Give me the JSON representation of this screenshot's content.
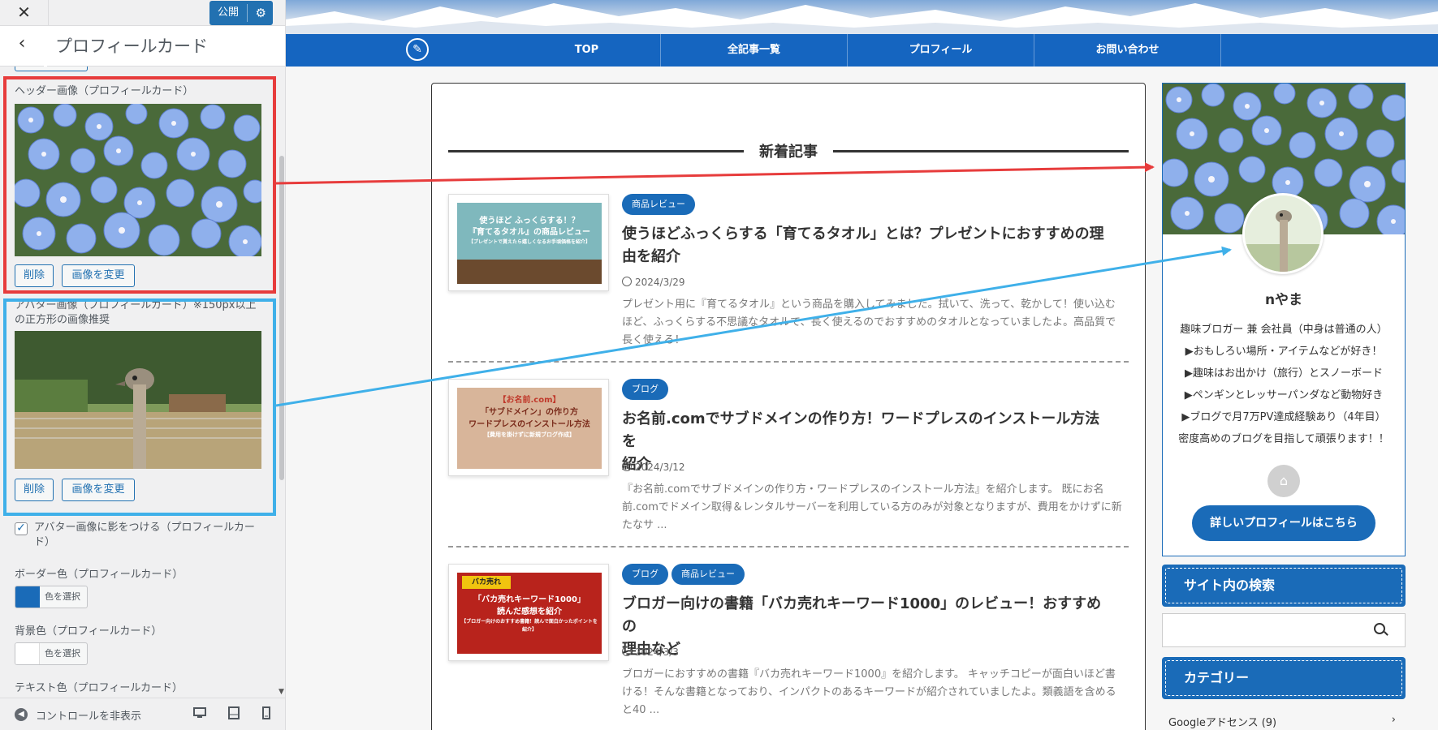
{
  "customizer": {
    "close_glyph": "✕",
    "publish_label": "公開",
    "back_glyph": "‹",
    "section_title": "プロフィールカード",
    "header_image": {
      "label": "ヘッダー画像（プロフィールカード）",
      "remove_label": "削除",
      "change_label": "画像を変更"
    },
    "avatar_image": {
      "label_line1": "アバター画像（プロフィールカード）※150px以上",
      "label_line2": "の正方形の画像推奨",
      "remove_label": "削除",
      "change_label": "画像を変更"
    },
    "avatar_shadow": {
      "label_line1": "アバター画像に影をつける（プロフィールカー",
      "label_line2": "ド）",
      "checked": true
    },
    "border_color": {
      "label": "ボーダー色（プロフィールカード）",
      "button_label": "色を選択",
      "swatch": "#1a6bb8"
    },
    "bg_color": {
      "label": "背景色（プロフィールカード）",
      "button_label": "色を選択",
      "swatch": "#ffffff"
    },
    "text_color": {
      "label": "テキスト色（プロフィールカード）"
    },
    "footer": {
      "hide_controls_label": "コントロールを非表示"
    }
  },
  "site": {
    "nav": [
      {
        "label": "TOP"
      },
      {
        "label": "全記事一覧"
      },
      {
        "label": "プロフィール"
      },
      {
        "label": "お問い合わせ"
      }
    ],
    "section_title": "新着記事",
    "posts": [
      {
        "badges": [
          "商品レビュー"
        ],
        "title_line1": "使うほどふっくらする「育てるタオル」とは？プレゼントにおすすめの理",
        "title_line2": "由を紹介",
        "date": "2024/3/29",
        "excerpt": "プレゼント用に『育てるタオル』という商品を購入してみました。拭いて、洗って、乾かして！使い込むほど、ふっくらする不思議なタオルで、長く使えるのでおすすめのタオルとなっていましたよ。高品質で長く使える！",
        "thumb_text_line1": "使うほど ふっくらする！？",
        "thumb_text_line2": "『育てるタオル』の商品レビュー",
        "thumb_text_line3": "【プレゼントで貰えたら嬉しくなるお手頃価格を紹介】"
      },
      {
        "badges": [
          "ブログ"
        ],
        "title_line1": "お名前.comでサブドメインの作り方！ワードプレスのインストール方法を",
        "title_line2": "紹介",
        "date": "2024/3/12",
        "excerpt": "『お名前.comでサブドメインの作り方・ワードプレスのインストール方法』を紹介します。 既にお名前.comでドメイン取得＆レンタルサーバーを利用している方のみが対象となりますが、費用をかけずに新たなサ ...",
        "thumb_text_line1": "【お名前.com】",
        "thumb_text_line2": "「サブドメイン」の作り方",
        "thumb_text_line3": "ワードプレスのインストール方法",
        "thumb_text_line4": "【費用を掛けずに新規ブログ作成】"
      },
      {
        "badges": [
          "ブログ",
          "商品レビュー"
        ],
        "title_line1": "ブロガー向けの書籍「バカ売れキーワード1000」のレビュー！おすすめの",
        "title_line2": "理由など",
        "date": "2024/3/3",
        "excerpt": "ブロガーにおすすめの書籍『バカ売れキーワード1000』を紹介します。 キャッチコピーが面白いほど書ける！そんな書籍となっており、インパクトのあるキーワードが紹介されていましたよ。類義語を含めると40 ...",
        "thumb_text_line1": "バカ売れ",
        "thumb_text_line2": "「バカ売れキーワード1000」",
        "thumb_text_line3": "読んだ感想を紹介",
        "thumb_text_line4": "【ブロガー向けのおすすめ書籍！読んで面白かったポイントを紹介】"
      }
    ],
    "profile": {
      "name": "nやま",
      "lines": [
        "趣味ブロガー 兼 会社員（中身は普通の人）",
        "▶おもしろい場所・アイテムなどが好き！",
        "▶趣味はお出かけ（旅行）とスノーボード",
        "▶ペンギンとレッサーパンダなど動物好き",
        "▶ブログで月7万PV達成経験あり（4年目）",
        "密度高めのブログを目指して頑張ります！！"
      ],
      "more_button": "詳しいプロフィールはこちら"
    },
    "widgets": {
      "search_title": "サイト内の検索",
      "category_title": "カテゴリー",
      "category_first": "Googleアドセンス (9)"
    }
  },
  "colors": {
    "annotation_red": "#e73c3c",
    "annotation_blue": "#3fb0e9",
    "brand_blue": "#1a6bb8",
    "nav_blue": "#1565c0"
  },
  "icons": {
    "close": "close-icon",
    "gear": "gear-icon",
    "back": "chevron-left-icon",
    "pencil": "pencil-icon",
    "home": "home-icon",
    "search": "search-icon",
    "clock": "clock-icon",
    "desktop": "desktop-icon",
    "tablet": "tablet-icon",
    "mobile": "mobile-icon"
  }
}
